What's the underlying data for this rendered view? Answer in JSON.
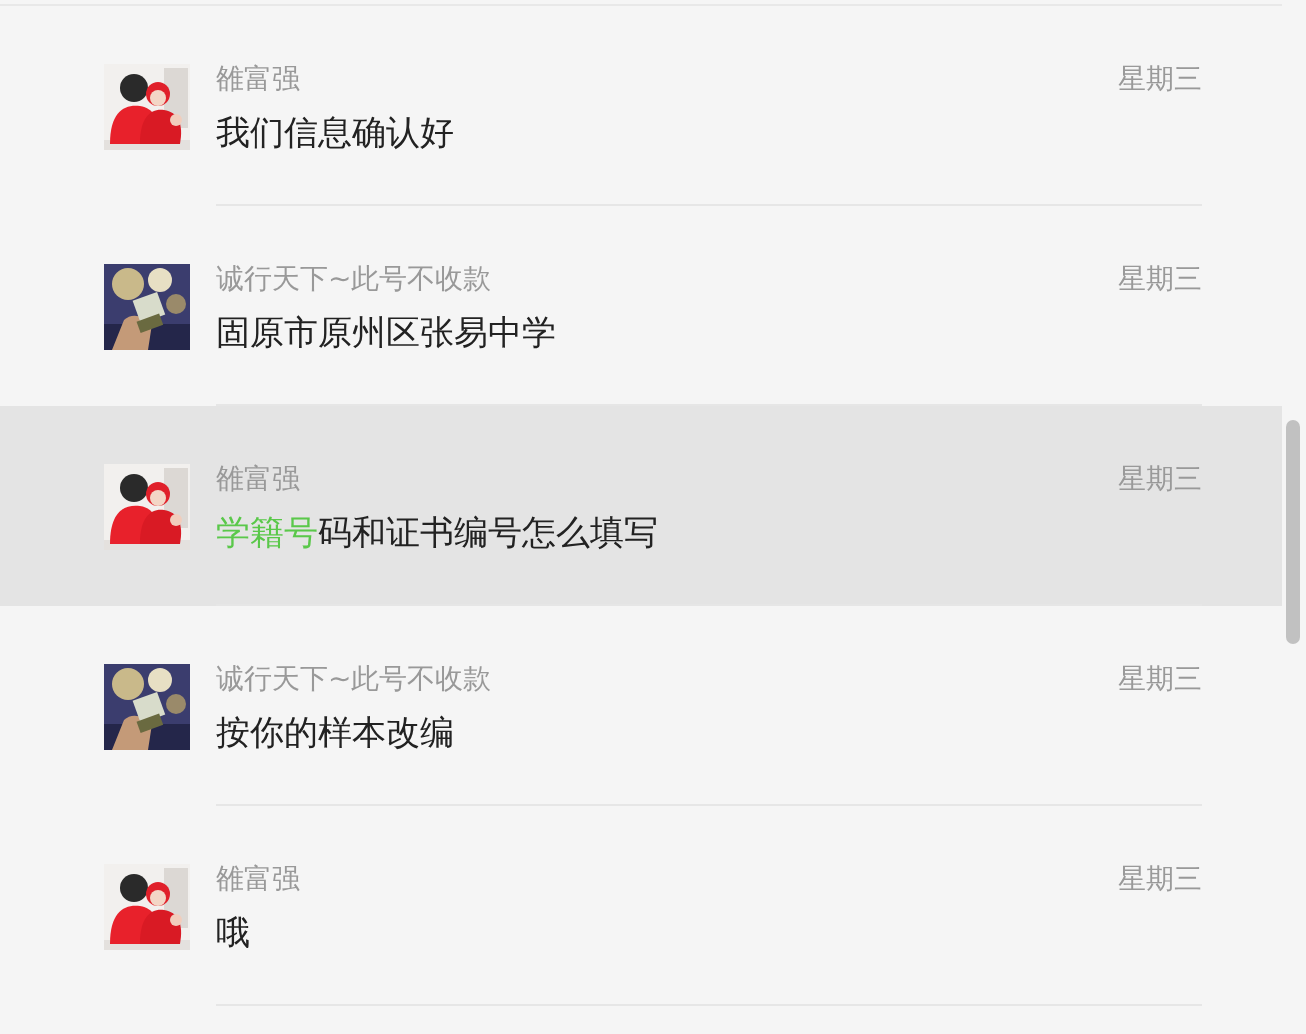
{
  "conversations": [
    {
      "sender": "雒富强",
      "time": "星期三",
      "message": "我们信息确认好",
      "selected": false
    },
    {
      "sender": "诚行天下~此号不收款",
      "time": "星期三",
      "message": "固原市原州区张易中学",
      "selected": false
    },
    {
      "sender": "雒富强",
      "time": "星期三",
      "message_link": "学籍号",
      "message": "码和证书编号怎么填写",
      "selected": true
    },
    {
      "sender": "诚行天下~此号不收款",
      "time": "星期三",
      "message": "按你的样本改编",
      "selected": false
    },
    {
      "sender": "雒富强",
      "time": "星期三",
      "message": "哦",
      "selected": false
    }
  ]
}
